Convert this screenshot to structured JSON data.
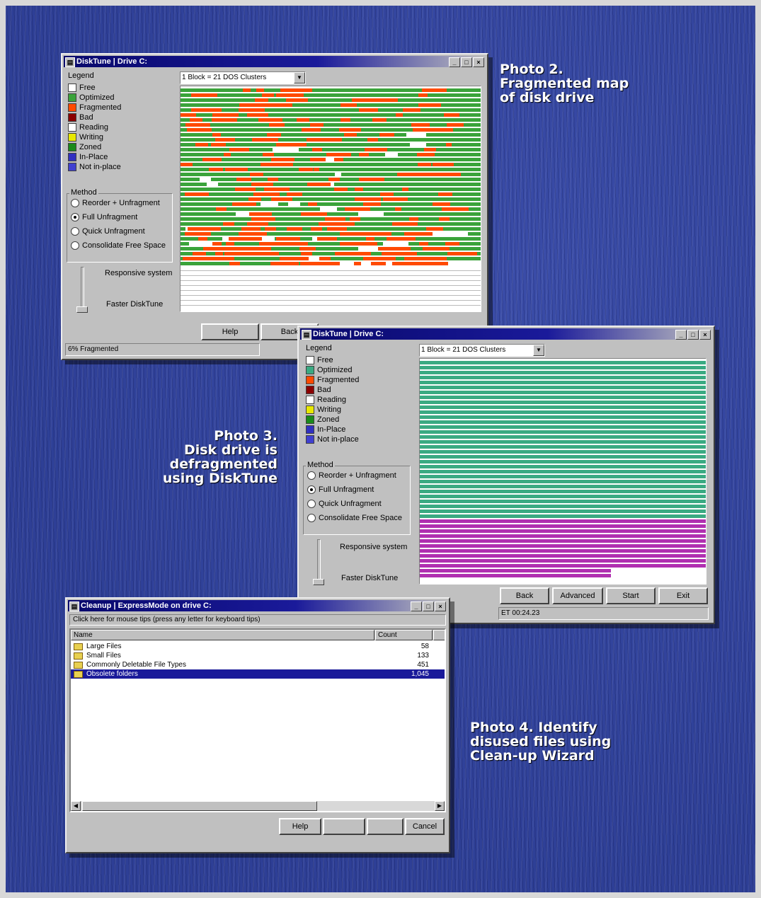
{
  "colors": {
    "free": "#ffffff",
    "optimized": "#3aa33a",
    "optimized_photo3": "#3aaa82",
    "fragmented": "#ff4a00",
    "bad": "#8b0000",
    "reading": "#ffffff",
    "writing": "#e8e800",
    "zoned": "#1a8a1a",
    "in_place": "#3030c0",
    "not_in_place": "#4040d0",
    "moved_purple": "#b030b0",
    "title_bar": "#08086b",
    "page_background": "#2e3f96"
  },
  "captions": {
    "photo2": [
      "Photo 2.",
      "Fragmented map",
      "of disk drive"
    ],
    "photo3": [
      "Photo 3.",
      "Disk drive is",
      "defragmented",
      "using DiskTune"
    ],
    "photo4": [
      "Photo 4. Identify",
      "disused files using",
      "Clean-up Wizard"
    ]
  },
  "photo2": {
    "title": "DiskTune | Drive C:",
    "legend_title": "Legend",
    "legend": [
      "Free",
      "Optimized",
      "Fragmented",
      "Bad",
      "Reading",
      "Writing",
      "Zoned",
      "In-Place",
      "Not in-place"
    ],
    "dropdown": "1 Block = 21 DOS Clusters",
    "method_title": "Method",
    "methods": [
      "Reorder + Unfragment",
      "Full Unfragment",
      "Quick Unfragment",
      "Consolidate Free Space"
    ],
    "selected_method": 1,
    "slider_top": "Responsive system",
    "slider_bottom": "Faster DiskTune",
    "buttons": [
      "Help",
      "Back"
    ],
    "status": "6% Fragmented"
  },
  "photo3": {
    "title": "DiskTune | Drive C:",
    "legend_title": "Legend",
    "legend": [
      "Free",
      "Optimized",
      "Fragmented",
      "Bad",
      "Reading",
      "Writing",
      "Zoned",
      "In-Place",
      "Not in-place"
    ],
    "dropdown": "1 Block = 21 DOS Clusters",
    "method_title": "Method",
    "methods": [
      "Reorder + Unfragment",
      "Full Unfragment",
      "Quick Unfragment",
      "Consolidate Free Space"
    ],
    "selected_method": 1,
    "slider_top": "Responsive system",
    "slider_bottom": "Faster DiskTune",
    "buttons": [
      "Back",
      "Advanced",
      "Start",
      "Exit"
    ],
    "status": "ET 00:24.23"
  },
  "photo4": {
    "title": "Cleanup | ExpressMode on drive C:",
    "tip": "Click here for mouse tips (press any letter for keyboard tips)",
    "columns": [
      "Name",
      "Count"
    ],
    "rows": [
      {
        "name": "Large Files",
        "count": "58"
      },
      {
        "name": "Small Files",
        "count": "133"
      },
      {
        "name": "Commonly Deletable File Types",
        "count": "451"
      },
      {
        "name": "Obsolete folders",
        "count": "1,045"
      }
    ],
    "selected_row": 3,
    "buttons": [
      "Help",
      "Cancel"
    ]
  }
}
